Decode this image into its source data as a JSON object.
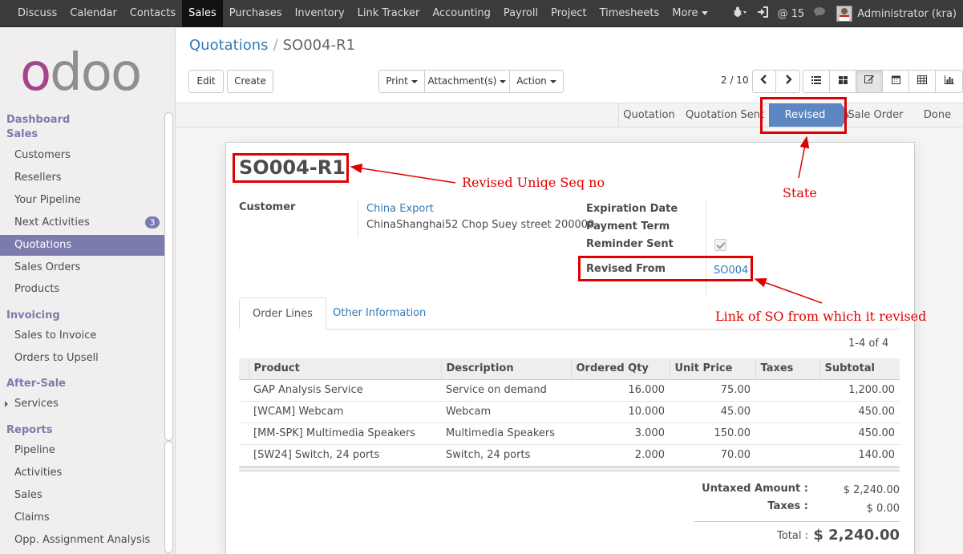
{
  "topbar": {
    "menu": [
      "Discuss",
      "Calendar",
      "Contacts",
      "Sales",
      "Purchases",
      "Inventory",
      "Link Tracker",
      "Accounting",
      "Payroll",
      "Project",
      "Timesheets",
      "More"
    ],
    "active": "Sales",
    "messages_count": "15",
    "user": "Administrator (kra)"
  },
  "sidebar": {
    "logo": "odoo",
    "sections": [
      {
        "title": "Dashboard"
      },
      {
        "title": "Sales",
        "items": [
          "Customers",
          "Resellers",
          "Your Pipeline",
          "Next Activities",
          "Quotations",
          "Sales Orders",
          "Products"
        ]
      },
      {
        "title": "Invoicing",
        "items": [
          "Sales to Invoice",
          "Orders to Upsell"
        ]
      },
      {
        "title": "After-Sale",
        "items": [
          "Services"
        ]
      },
      {
        "title": "Reports",
        "items": [
          "Pipeline",
          "Activities",
          "Sales",
          "Claims",
          "Opp. Assignment Analysis"
        ]
      }
    ],
    "next_activities_badge": "3",
    "active_item": "Quotations"
  },
  "breadcrumb": {
    "parent": "Quotations",
    "separator": "/",
    "current": "SO004-R1"
  },
  "buttons": {
    "edit": "Edit",
    "create": "Create",
    "print": "Print",
    "attachments": "Attachment(s)",
    "action": "Action"
  },
  "pager": {
    "value": "2 / 10"
  },
  "status": {
    "stages": [
      "Quotation",
      "Quotation Sent",
      "Revised",
      "Sale Order",
      "Done"
    ],
    "active": "Revised"
  },
  "form": {
    "title": "SO004-R1",
    "customer_label": "Customer",
    "customer_name": "China Export",
    "customer_address": "ChinaShanghai52 Chop Suey street 200000",
    "expiration_label": "Expiration Date",
    "payment_label": "Payment Term",
    "reminder_label": "Reminder Sent",
    "revised_from_label": "Revised From",
    "revised_from_value": "SO004"
  },
  "tabs": [
    "Order Lines",
    "Other Information"
  ],
  "table": {
    "count": "1-4 of 4",
    "headers": [
      "Product",
      "Description",
      "Ordered Qty",
      "Unit Price",
      "Taxes",
      "Subtotal"
    ],
    "rows": [
      [
        "GAP Analysis Service",
        "Service on demand",
        "16.000",
        "75.00",
        "",
        "1,200.00"
      ],
      [
        "[WCAM] Webcam",
        "Webcam",
        "10.000",
        "45.00",
        "",
        "450.00"
      ],
      [
        "[MM-SPK] Multimedia Speakers",
        "Multimedia Speakers",
        "3.000",
        "150.00",
        "",
        "450.00"
      ],
      [
        "[SW24] Switch, 24 ports",
        "Switch, 24 ports",
        "2.000",
        "70.00",
        "",
        "140.00"
      ]
    ]
  },
  "totals": {
    "untaxed_label": "Untaxed Amount :",
    "untaxed_value": "$ 2,240.00",
    "taxes_label": "Taxes :",
    "taxes_value": "$ 0.00",
    "total_label": "Total :",
    "total_value": "$ 2,240.00"
  },
  "annotations": {
    "seq": "Revised Uniqe Seq no",
    "state": "State",
    "link": "Link of SO from which it revised",
    "color": "#e00000"
  },
  "colors": {
    "accent": "#7c7bad",
    "link": "#337ab7",
    "active_stage": "#5c87c2",
    "odoo_purple": "#a24689"
  }
}
